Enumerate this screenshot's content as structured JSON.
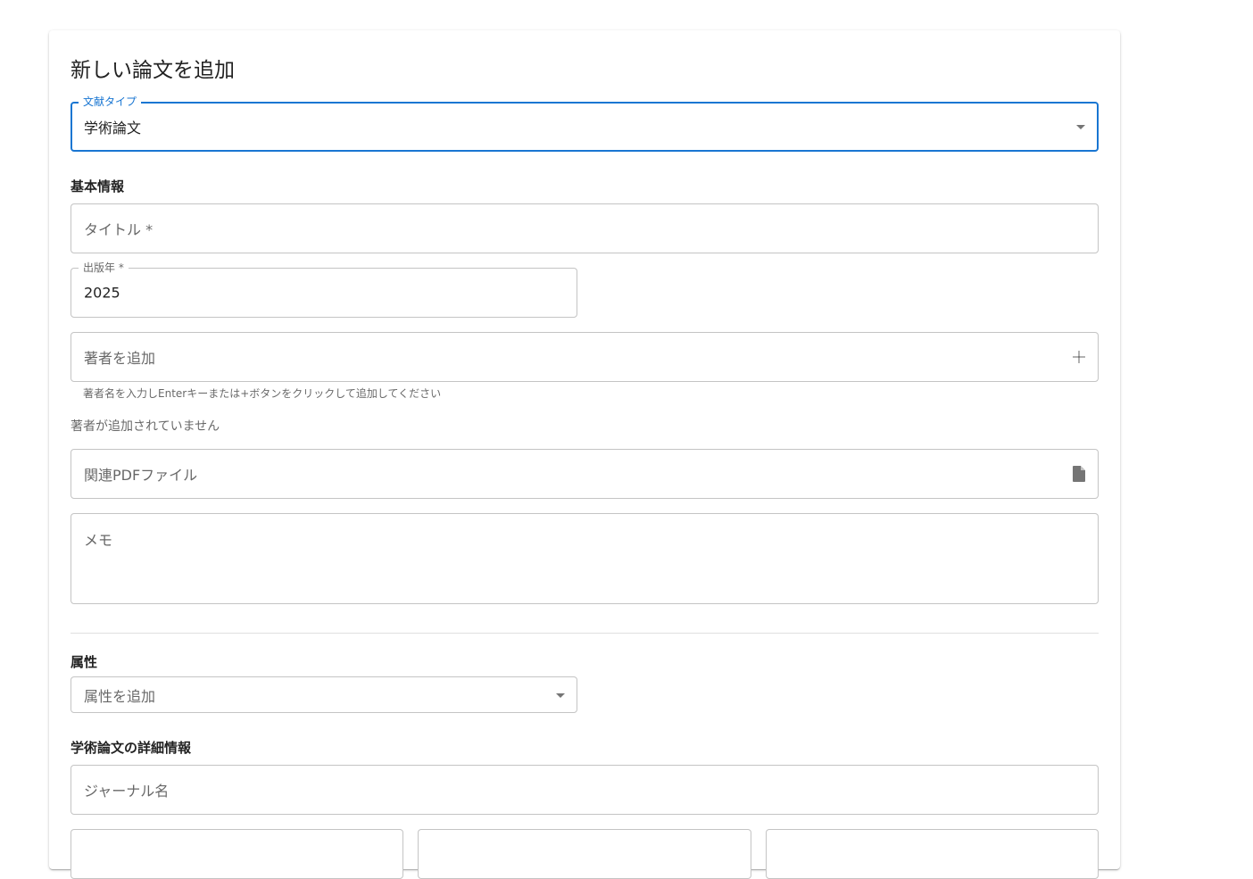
{
  "dialog": {
    "title": "新しい論文を追加"
  },
  "doc_type": {
    "label": "文献タイプ",
    "value": "学術論文"
  },
  "basic_info": {
    "heading": "基本情報",
    "title_placeholder": "タイトル *",
    "year_label": "出版年 *",
    "year_value": "2025",
    "author_placeholder": "著者を追加",
    "author_helper": "著者名を入力しEnterキーまたは+ボタンをクリックして追加してください",
    "no_authors": "著者が追加されていません",
    "pdf_placeholder": "関連PDFファイル",
    "memo_placeholder": "メモ"
  },
  "attributes": {
    "heading": "属性",
    "select_placeholder": "属性を追加"
  },
  "paper_details": {
    "heading": "学術論文の詳細情報",
    "journal_placeholder": "ジャーナル名"
  },
  "icons": {
    "add": "plus-icon",
    "file": "file-icon",
    "dropdown": "arrow-drop-down-icon"
  },
  "colors": {
    "primary": "#1976d2"
  }
}
